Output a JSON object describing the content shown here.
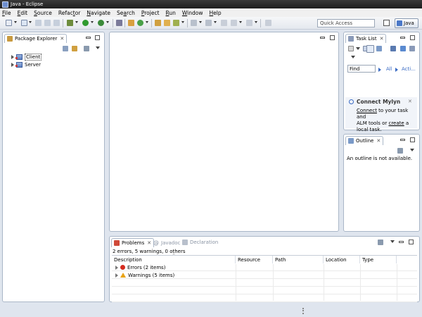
{
  "window": {
    "title": "Java - Eclipse"
  },
  "menu": [
    {
      "first": "F",
      "rest": "ile"
    },
    {
      "first": "E",
      "rest": "dit"
    },
    {
      "first": "S",
      "rest": "ource"
    },
    {
      "pre": "Refac",
      "first": "t",
      "rest": "or"
    },
    {
      "first": "N",
      "rest": "avigate"
    },
    {
      "pre": "Se",
      "first": "a",
      "rest": "rch"
    },
    {
      "first": "P",
      "rest": "roject"
    },
    {
      "first": "R",
      "rest": "un"
    },
    {
      "first": "W",
      "rest": "indow"
    },
    {
      "first": "H",
      "rest": "elp"
    }
  ],
  "toolbar": {
    "quick_access_placeholder": "Quick Access",
    "perspective_label": "Java"
  },
  "package_explorer": {
    "tab_label": "Package Explorer",
    "projects": [
      "Client",
      "Server"
    ]
  },
  "task_list": {
    "tab_label": "Task List",
    "find_placeholder": "Find",
    "filter_all": "All",
    "filter_active": "Acti..."
  },
  "mylyn": {
    "title": "Connect Mylyn",
    "link_connect": "Connect",
    "text_1": " to your task and",
    "text_2": "ALM tools or ",
    "link_create": "create",
    "text_3": " a",
    "text_4": "local task."
  },
  "outline": {
    "tab_label": "Outline",
    "empty_message": "An outline is not available."
  },
  "bottom": {
    "tabs": [
      "Problems",
      "Javadoc",
      "Declaration"
    ],
    "summary": "2 errors, 5 warnings, 0 others",
    "columns": [
      "Description",
      "Resource",
      "Path",
      "Location",
      "Type"
    ],
    "rows": [
      {
        "kind": "error",
        "label": "Errors (2 items)"
      },
      {
        "kind": "warning",
        "label": "Warnings (5 items)"
      }
    ]
  },
  "colors": {
    "accent": "#3a6bc4",
    "background": "#dfe5ee",
    "error": "#d52b1e",
    "warning": "#e8a317"
  }
}
